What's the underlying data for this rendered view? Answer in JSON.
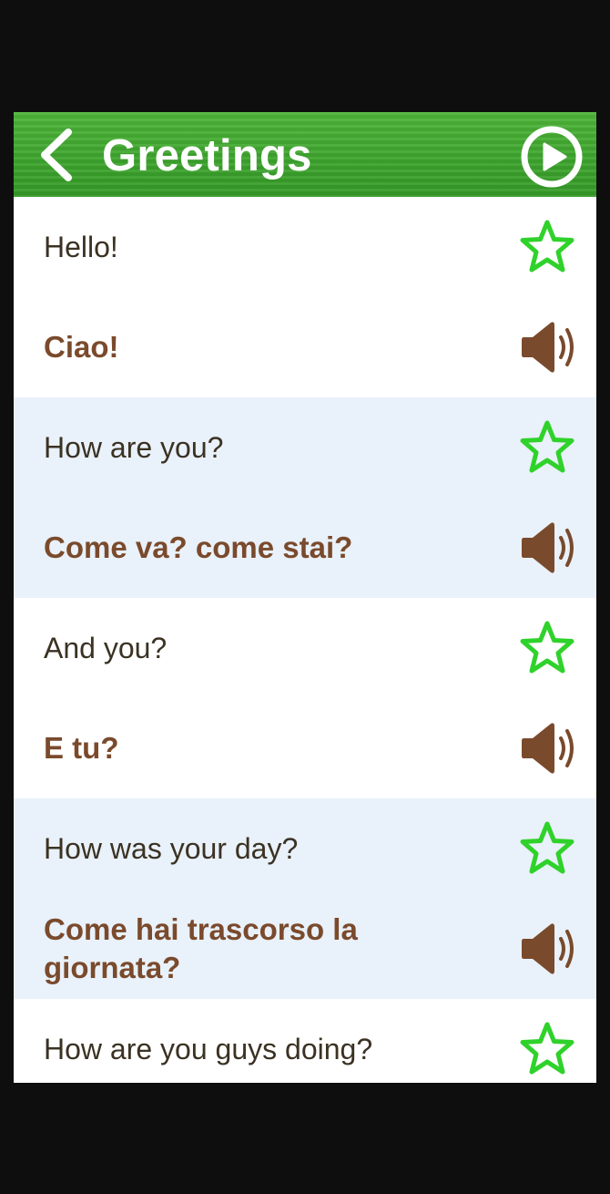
{
  "header": {
    "title": "Greetings"
  },
  "colors": {
    "header_green": "#3ea52e",
    "star_green": "#2fd22a",
    "italian_brown": "#7a4a2c",
    "speaker_brown": "#7a4a2c",
    "alt_row_blue": "#e9f1fa"
  },
  "phrases": [
    {
      "english": "Hello!",
      "italian": "Ciao!"
    },
    {
      "english": "How are you?",
      "italian": "Come va? come stai?"
    },
    {
      "english": "And you?",
      "italian": "E tu?"
    },
    {
      "english": "How was your day?",
      "italian": "Come hai trascorso la giornata?"
    },
    {
      "english": "How are you guys doing?",
      "italian": ""
    }
  ],
  "icons": {
    "back": "chevron-left-icon",
    "play": "play-circle-icon",
    "favorite": "star-outline-icon",
    "audio": "speaker-icon"
  }
}
